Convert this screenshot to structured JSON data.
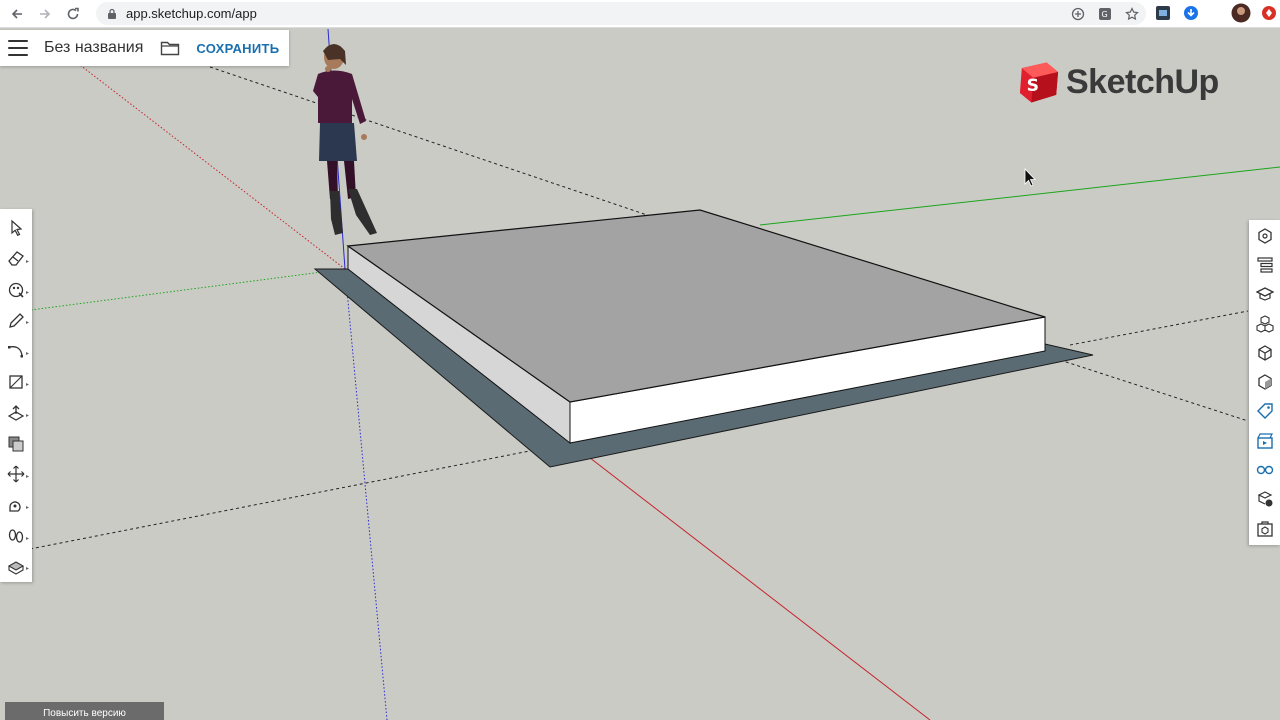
{
  "browser": {
    "url": "app.sketchup.com/app",
    "icons": [
      "back-icon",
      "forward-icon",
      "reload-icon",
      "lock-icon",
      "add-icon",
      "translate-icon",
      "bookmark-star-icon",
      "extension-icon",
      "download-icon",
      "profile-avatar",
      "extension-red-icon"
    ]
  },
  "app": {
    "file_title": "Без названия",
    "save_label": "СОХРАНИТЬ",
    "logo_text": "SketchUp",
    "upgrade_label": "Повысить версию",
    "accent": "#1a6faf",
    "brand_red": "#e0202e"
  },
  "left_toolbar": [
    "select-icon",
    "eraser-icon",
    "paint-bucket-icon",
    "pencil-icon",
    "arc-icon",
    "rectangle-icon",
    "push-pull-icon",
    "offset-icon",
    "move-icon",
    "tape-measure-icon",
    "walk-icon",
    "orbit-icon"
  ],
  "right_toolbar": [
    "entity-info-icon",
    "outliner-icon",
    "instructor-icon",
    "components-icon",
    "solid-tools-icon",
    "styles-icon",
    "tags-icon",
    "scenes-icon",
    "display-icon",
    "materials-icon",
    "3d-warehouse-icon"
  ]
}
